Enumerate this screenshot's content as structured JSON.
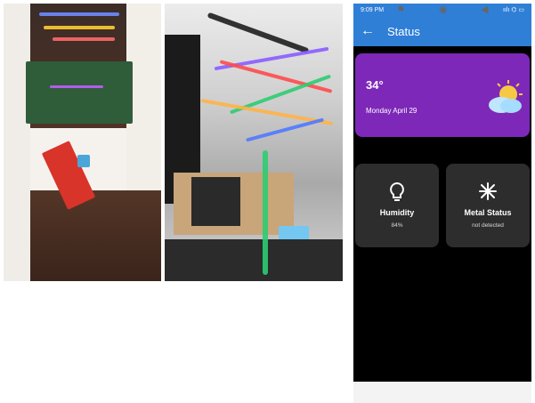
{
  "status_bar": {
    "time": "9:09 PM",
    "right": "ıılı ⌬ ▭"
  },
  "appbar": {
    "back_icon": "arrow-left-icon",
    "title": "Status"
  },
  "weather": {
    "temperature": "34°",
    "date": "Monday April 29",
    "icon": "sun-behind-cloud-icon",
    "card_color": "#7d28b8"
  },
  "tiles": [
    {
      "title": "Humidity",
      "value": "84%",
      "icon": "lightbulb-icon"
    },
    {
      "title": "Metal Status",
      "value": "not detected",
      "icon": "snowflake-icon"
    }
  ],
  "nav": {
    "square": "■",
    "home": "◉",
    "back": "◀"
  },
  "colors": {
    "appbar": "#2f7fd7",
    "tile": "#2d2d2d",
    "background": "#000000"
  }
}
